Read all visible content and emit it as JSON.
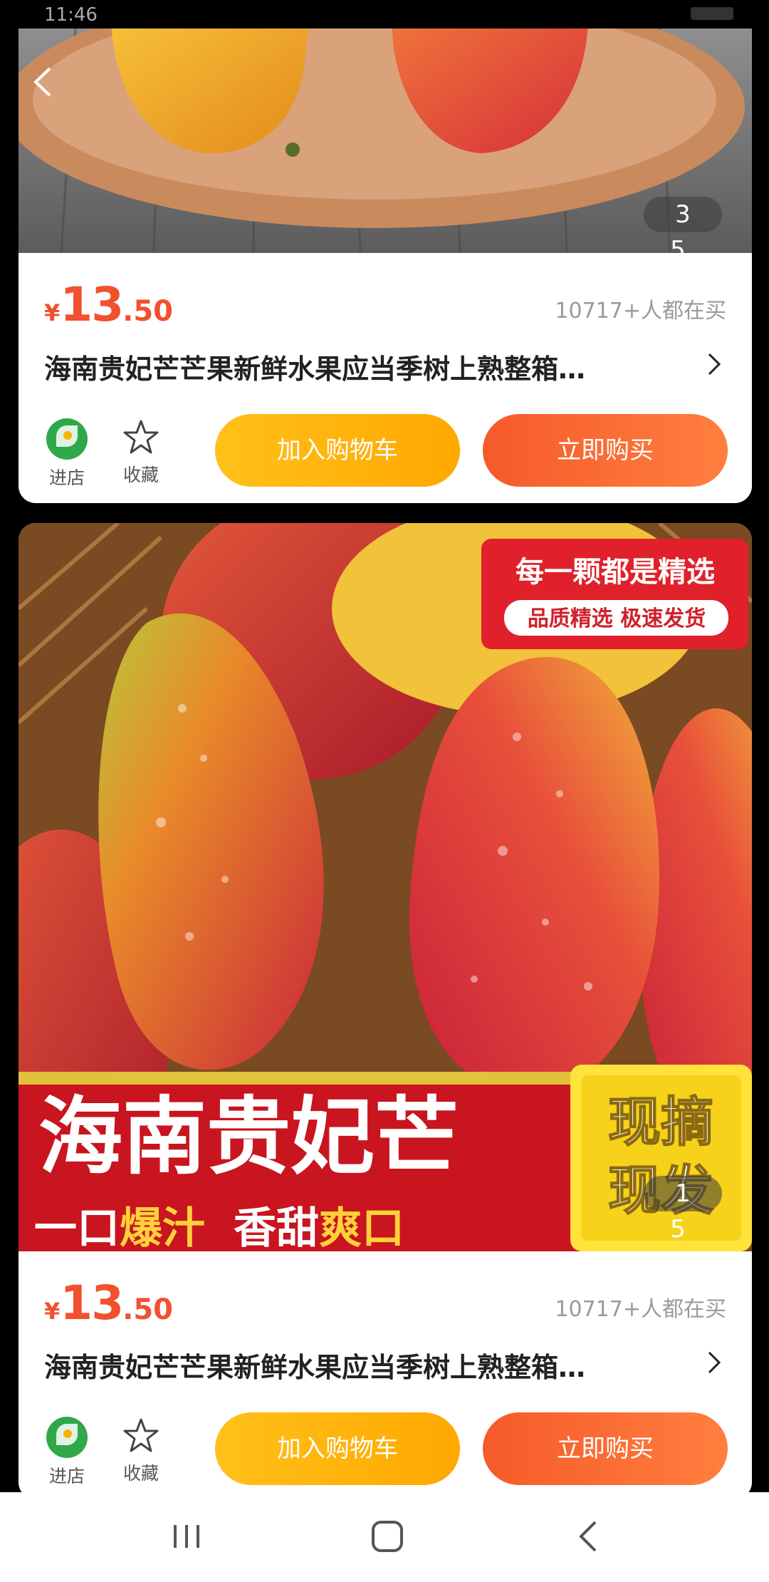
{
  "status_bar": {
    "time": "11:46"
  },
  "cards": [
    {
      "image_counter": "3 5",
      "price": {
        "currency": "¥",
        "integer": "13",
        "decimal": ".50"
      },
      "buyers": "10717+人都在买",
      "title": "海南贵妃芒芒果新鲜水果应当季树上熟整箱…",
      "store_label": "进店",
      "favorite_label": "收藏",
      "add_to_cart": "加入购物车",
      "buy_now": "立即购买"
    },
    {
      "image_counter": "1 5",
      "image_overlay": {
        "banner_top": "每一颗都是精选",
        "banner_sub": "品质精选 极速发货",
        "headline": "海南贵妃芒",
        "tagline_1": "一口",
        "tagline_2": "爆汁",
        "tagline_3": "香甜",
        "tagline_4": "爽口",
        "badge_1": "现摘",
        "badge_2": "现发"
      },
      "price": {
        "currency": "¥",
        "integer": "13",
        "decimal": ".50"
      },
      "buyers": "10717+人都在买",
      "title": "海南贵妃芒芒果新鲜水果应当季树上熟整箱…",
      "store_label": "进店",
      "favorite_label": "收藏",
      "add_to_cart": "加入购物车",
      "buy_now": "立即购买"
    }
  ],
  "colors": {
    "price": "#f2502f",
    "cart_button": "#ffb400",
    "buy_button": "#f9642f"
  }
}
